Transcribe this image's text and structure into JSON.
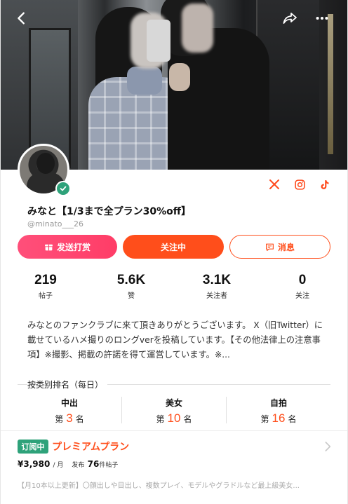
{
  "profile": {
    "name": "みなと【1/3まで全プラン30%off】",
    "handle": "@minato___26"
  },
  "actions": {
    "tip_label": "发送打赏",
    "follow_label": "关注中",
    "message_label": "消息"
  },
  "stats": [
    {
      "value": "219",
      "label": "帖子"
    },
    {
      "value": "5.6K",
      "label": "赞"
    },
    {
      "value": "3.1K",
      "label": "关注者"
    },
    {
      "value": "0",
      "label": "关注"
    }
  ],
  "bio": "みなとのファンクラブに来て頂きありがとうございます。 X（旧Twitter）に載せているハメ撮りのロングverを投稿しています。【その他法律上の注意事項】※撮影、掲載の許諾を得て運営しています。※...",
  "ranking": {
    "title": "按类别排名（每日）",
    "items": [
      {
        "category": "中出",
        "prefix": "第",
        "rank": "3",
        "suffix": "名"
      },
      {
        "category": "美女",
        "prefix": "第",
        "rank": "10",
        "suffix": "名"
      },
      {
        "category": "自拍",
        "prefix": "第",
        "rank": "16",
        "suffix": "名"
      }
    ]
  },
  "plan": {
    "badge": "订阅中",
    "name": "プレミアムプラン",
    "price": "¥3,980",
    "price_unit": "/ 月",
    "posts_prefix": "发布",
    "posts_count": "76",
    "posts_suffix": "件帖子",
    "description": "【月10本以上更新】〇顔出しや目出し、複数プレイ、モデルやグラドルなど最上級美女..."
  },
  "icons": {
    "back": "chevron-left-icon",
    "share": "share-icon",
    "more": "more-dots-icon",
    "verified": "verified-check-icon",
    "x": "x-logo-icon",
    "instagram": "instagram-icon",
    "tiktok": "tiktok-icon",
    "tip": "gift-icon",
    "message": "chat-icon",
    "plan_chevron": "chevron-right-icon"
  },
  "colors": {
    "accent": "#ff4e1b",
    "tip": "#ff3d67",
    "verified": "#2ea27a"
  }
}
